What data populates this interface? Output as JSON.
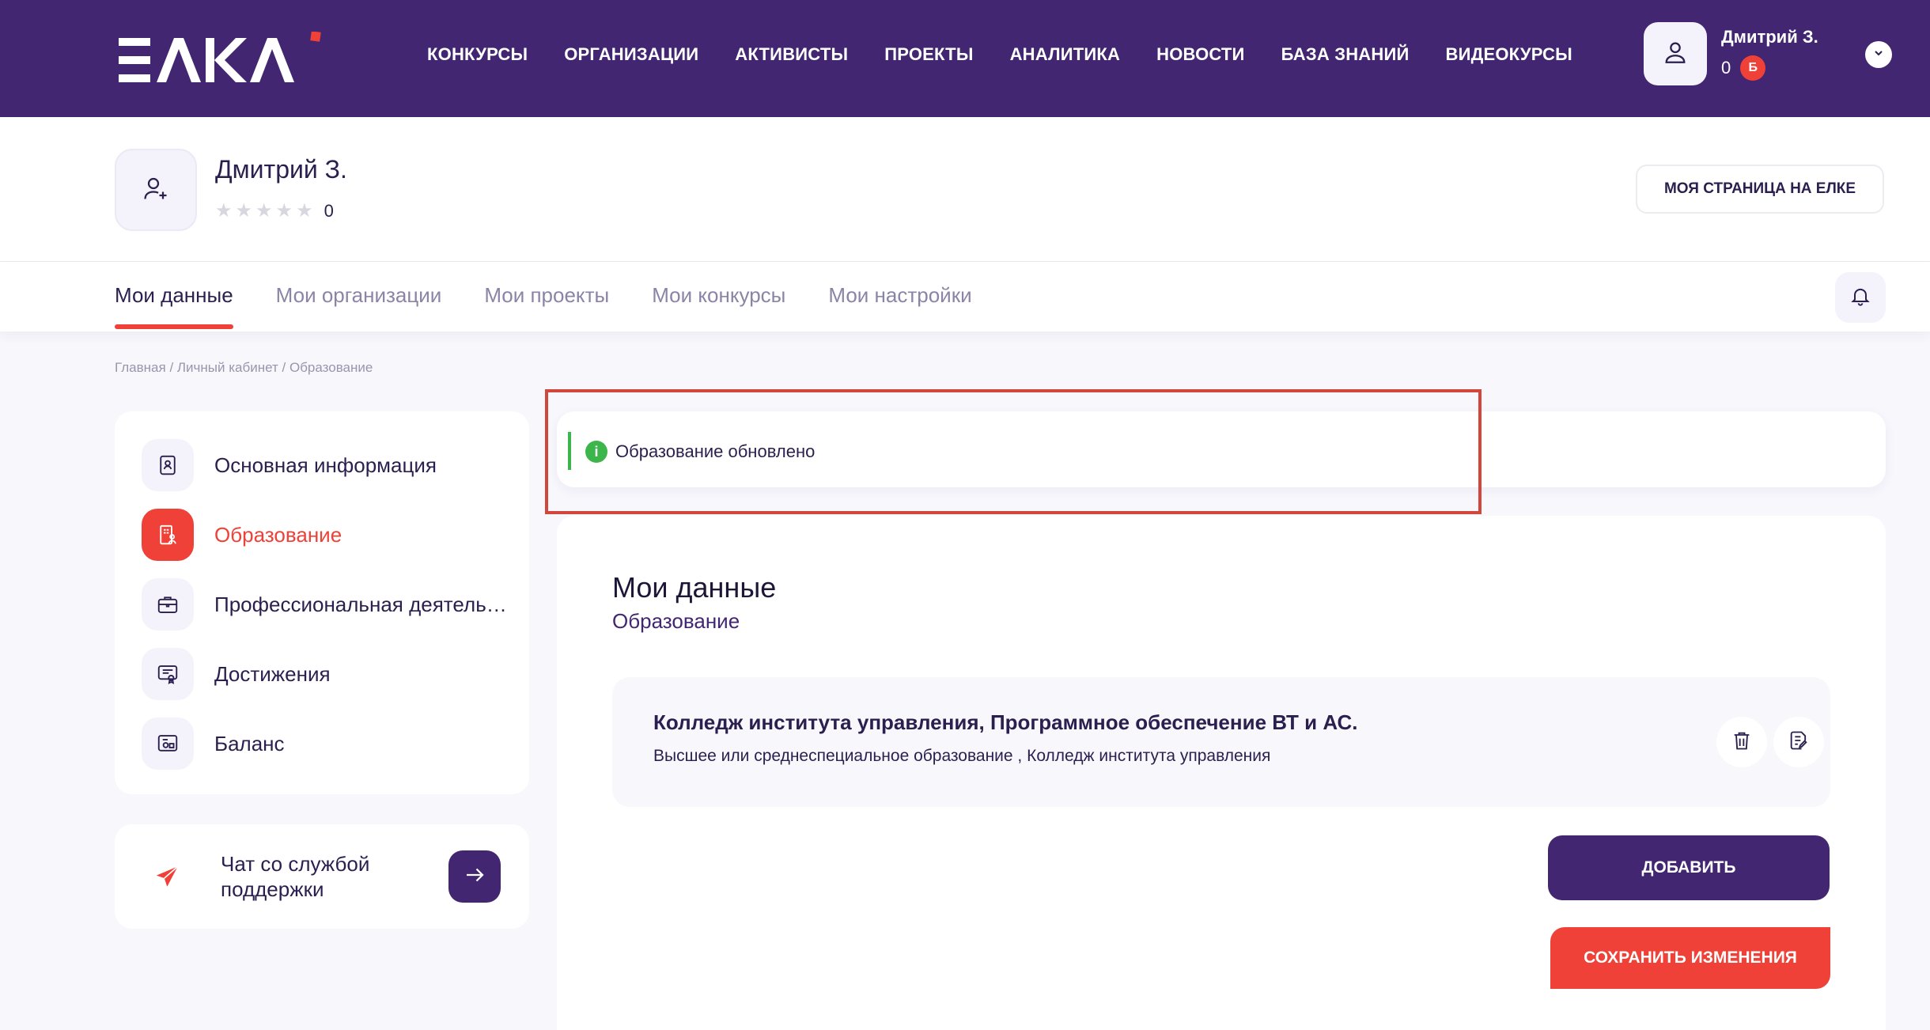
{
  "header": {
    "logo_text": "ЕЛКА",
    "nav": [
      "КОНКУРСЫ",
      "ОРГАНИЗАЦИИ",
      "АКТИВИСТЫ",
      "ПРОЕКТЫ",
      "АНАЛИТИКА",
      "НОВОСТИ",
      "БАЗА ЗНАНИЙ",
      "ВИДЕОКУРСЫ"
    ],
    "user_name": "Дмитрий З.",
    "balance": "0",
    "balance_badge": "Б",
    "colors": {
      "brand": "#422672",
      "accent": "#ef4137"
    }
  },
  "profile": {
    "name": "Дмитрий З.",
    "stars_filled": 0,
    "stars_total": 5,
    "rating": "0",
    "my_page_button": "МОЯ СТРАНИЦА НА ЕЛКЕ"
  },
  "tabs": {
    "items": [
      "Мои данные",
      "Мои организации",
      "Мои проекты",
      "Мои конкурсы",
      "Мои настройки"
    ],
    "active": "Мои данные"
  },
  "breadcrumb": {
    "items": [
      "Главная",
      "Личный кабинет",
      "Образование"
    ],
    "separator": " / "
  },
  "sidebar": {
    "items": [
      {
        "label": "Основная информация",
        "icon": "profile-document-icon"
      },
      {
        "label": "Образование",
        "icon": "education-building-icon",
        "active": true
      },
      {
        "label": "Профессиональная деятельность",
        "icon": "briefcase-icon"
      },
      {
        "label": "Достижения",
        "icon": "certificate-icon"
      },
      {
        "label": "Баланс",
        "icon": "wallet-icon"
      }
    ]
  },
  "support": {
    "label": "Чат со службой поддержки",
    "icon": "paper-plane-icon"
  },
  "alert": {
    "text": "Образование обновлено",
    "icon": "info-icon",
    "color": "#3cb64a"
  },
  "content": {
    "title": "Мои данные",
    "subtitle": "Образование",
    "education": [
      {
        "title": "Колледж института управления, Программное обеспечение ВТ и АС.",
        "description": "Высшее или среднеспециальное образование , Колледж института управления"
      }
    ],
    "add_button": "ДОБАВИТЬ",
    "save_button": "СОХРАНИТЬ ИЗМЕНЕНИЯ"
  }
}
